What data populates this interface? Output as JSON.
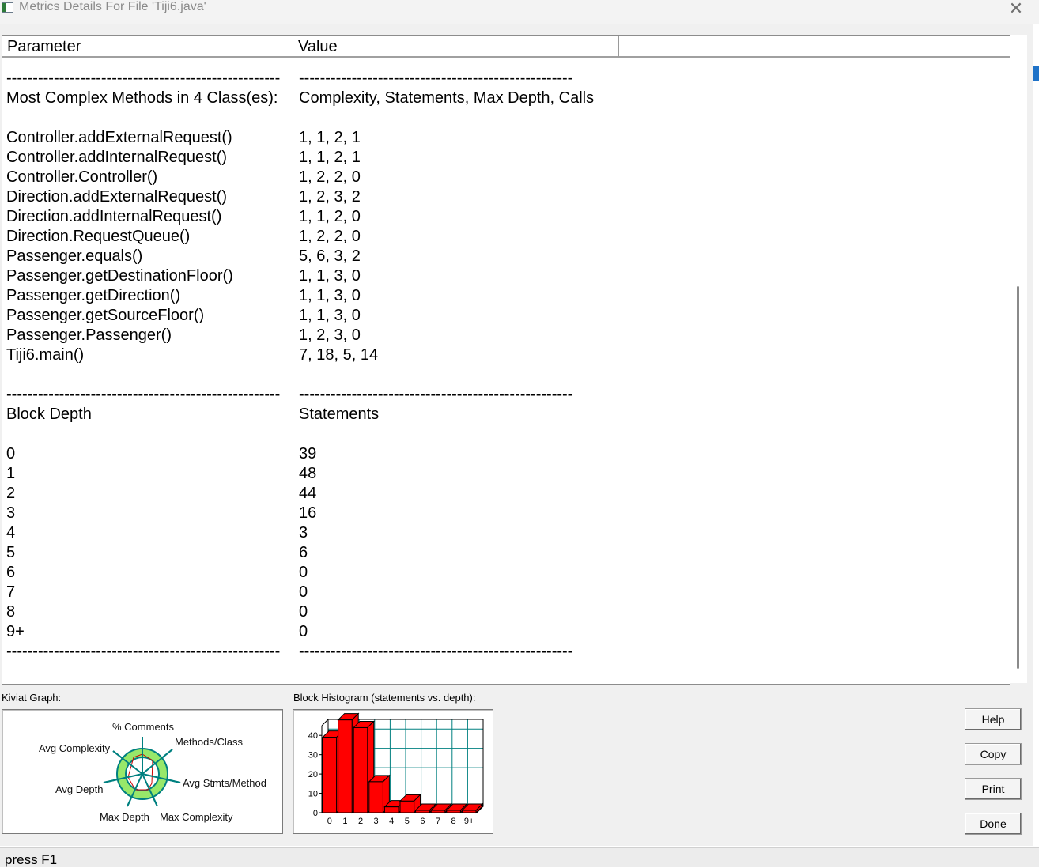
{
  "window": {
    "title": "Metrics Details For File 'Tiji6.java'"
  },
  "table": {
    "headers": {
      "parameter": "Parameter",
      "value": "Value"
    },
    "rows": [
      {
        "p": "----------------------------------------------------",
        "v": "----------------------------------------------------"
      },
      {
        "p": "Most Complex Methods in 4 Class(es):",
        "v": "Complexity, Statements, Max Depth, Calls"
      },
      {
        "p": "",
        "v": ""
      },
      {
        "p": "Controller.addExternalRequest()",
        "v": "1, 1, 2, 1"
      },
      {
        "p": "Controller.addInternalRequest()",
        "v": "1, 1, 2, 1"
      },
      {
        "p": "Controller.Controller()",
        "v": "1, 2, 2, 0"
      },
      {
        "p": "Direction.addExternalRequest()",
        "v": "1, 2, 3, 2"
      },
      {
        "p": "Direction.addInternalRequest()",
        "v": "1, 1, 2, 0"
      },
      {
        "p": "Direction.RequestQueue()",
        "v": "1, 2, 2, 0"
      },
      {
        "p": "Passenger.equals()",
        "v": "5, 6, 3, 2"
      },
      {
        "p": "Passenger.getDestinationFloor()",
        "v": "1, 1, 3, 0"
      },
      {
        "p": "Passenger.getDirection()",
        "v": "1, 1, 3, 0"
      },
      {
        "p": "Passenger.getSourceFloor()",
        "v": "1, 1, 3, 0"
      },
      {
        "p": "Passenger.Passenger()",
        "v": "1, 2, 3, 0"
      },
      {
        "p": "Tiji6.main()",
        "v": "7, 18, 5, 14"
      },
      {
        "p": "",
        "v": ""
      },
      {
        "p": "----------------------------------------------------",
        "v": "----------------------------------------------------"
      },
      {
        "p": "Block Depth",
        "v": "Statements"
      },
      {
        "p": "",
        "v": ""
      },
      {
        "p": "0",
        "v": "39"
      },
      {
        "p": "1",
        "v": "48"
      },
      {
        "p": "2",
        "v": "44"
      },
      {
        "p": "3",
        "v": "16"
      },
      {
        "p": "4",
        "v": "3"
      },
      {
        "p": "5",
        "v": "6"
      },
      {
        "p": "6",
        "v": "0"
      },
      {
        "p": "7",
        "v": "0"
      },
      {
        "p": "8",
        "v": "0"
      },
      {
        "p": "9+",
        "v": "0"
      },
      {
        "p": "----------------------------------------------------",
        "v": "----------------------------------------------------"
      }
    ]
  },
  "kiviat": {
    "label": "Kiviat Graph:",
    "axes": {
      "comments": "% Comments",
      "methods_class": "Methods/Class",
      "avg_stmts": "Avg Stmts/Method",
      "max_complexity": "Max Complexity",
      "max_depth": "Max Depth",
      "avg_depth": "Avg Depth",
      "avg_complexity": "Avg Complexity"
    }
  },
  "histogram": {
    "label": "Block Histogram (statements vs. depth):",
    "chart_data": {
      "type": "bar",
      "categories": [
        "0",
        "1",
        "2",
        "3",
        "4",
        "5",
        "6",
        "7",
        "8",
        "9+"
      ],
      "values": [
        39,
        48,
        44,
        16,
        3,
        6,
        0,
        0,
        0,
        0
      ],
      "yticks": [
        "0",
        "10",
        "20",
        "30",
        "40"
      ],
      "ylim": [
        0,
        45
      ],
      "bar_color": "#ff0000"
    }
  },
  "buttons": {
    "help": "Help",
    "copy": "Copy",
    "print": "Print",
    "done": "Done"
  },
  "status": {
    "text": "press F1"
  }
}
